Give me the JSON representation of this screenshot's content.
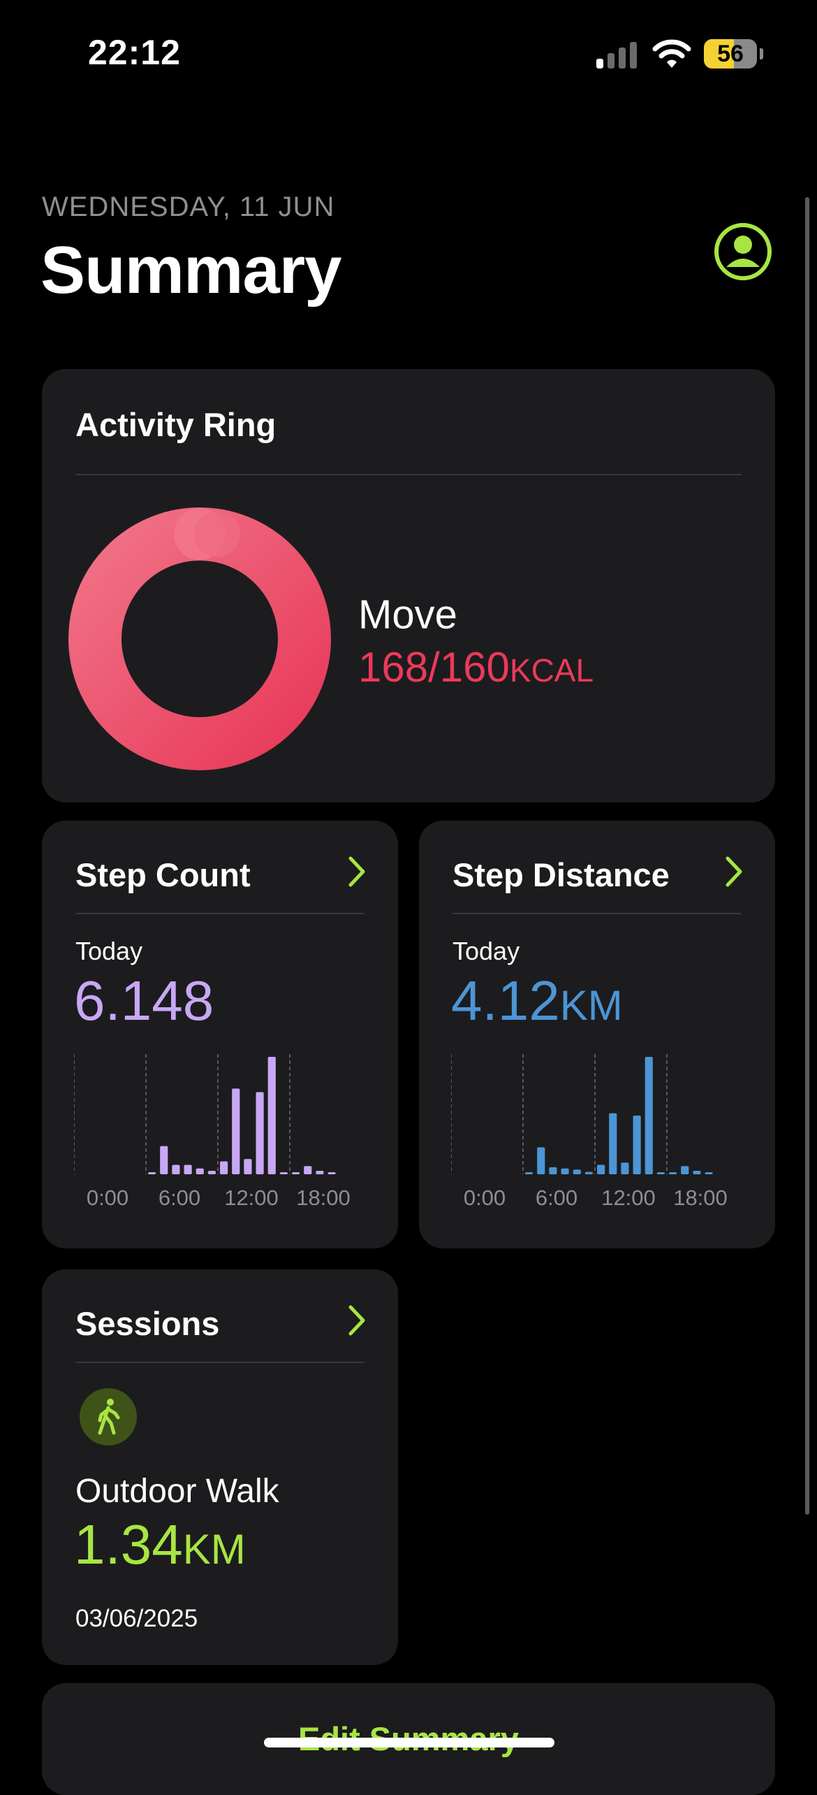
{
  "status_bar": {
    "time": "22:12",
    "signal_icon": "cellular-signal-icon",
    "wifi_icon": "wifi-icon",
    "battery_level": "56",
    "battery_fraction": 0.56,
    "battery_color": "#f5d232"
  },
  "header": {
    "date": "WEDNESDAY, 11 JUN",
    "title": "Summary",
    "profile_icon": "person-circle-icon"
  },
  "colors": {
    "accent": "#a8e543",
    "move_red": "#ec3a5a",
    "steps_purple": "#c8a8f5",
    "distance_blue": "#4c95d6",
    "card_bg": "#1c1c1e"
  },
  "activity_ring": {
    "title": "Activity Ring",
    "label": "Move",
    "value": "168/160",
    "unit": "KCAL",
    "current": 168,
    "goal": 160
  },
  "step_count": {
    "title": "Step Count",
    "period": "Today",
    "value": "6.148",
    "unit": "",
    "chevron_icon": "chevron-right-icon"
  },
  "step_distance": {
    "title": "Step Distance",
    "period": "Today",
    "value": "4.12",
    "unit": "KM",
    "chevron_icon": "chevron-right-icon"
  },
  "sessions": {
    "title": "Sessions",
    "chevron_icon": "chevron-right-icon",
    "workout_icon": "figure-walk-icon",
    "workout_name": "Outdoor Walk",
    "distance": "1.34",
    "unit": "KM",
    "date": "03/06/2025"
  },
  "edit_summary": {
    "label": "Edit Summary"
  },
  "chart_data": [
    {
      "type": "bar",
      "title": "Step Count",
      "x_tick_labels": [
        "0:00",
        "6:00",
        "12:00",
        "18:00"
      ],
      "categories": [
        "0",
        "1",
        "2",
        "3",
        "4",
        "5",
        "6",
        "7",
        "8",
        "9",
        "10",
        "11",
        "12",
        "13",
        "14",
        "15",
        "16",
        "17",
        "18",
        "19",
        "20",
        "21",
        "22",
        "23"
      ],
      "values": [
        0,
        0,
        0,
        0,
        0,
        0,
        1.5,
        24,
        8,
        8,
        5,
        3,
        11,
        73,
        13,
        70,
        100,
        1.5,
        1.5,
        7,
        3,
        1.5,
        0,
        0
      ],
      "color": "#c8a8f5",
      "grid": "vertical dashed at 0:00, 6:00, 12:00, 18:00"
    },
    {
      "type": "bar",
      "title": "Step Distance",
      "x_tick_labels": [
        "0:00",
        "6:00",
        "12:00",
        "18:00"
      ],
      "categories": [
        "0",
        "1",
        "2",
        "3",
        "4",
        "5",
        "6",
        "7",
        "8",
        "9",
        "10",
        "11",
        "12",
        "13",
        "14",
        "15",
        "16",
        "17",
        "18",
        "19",
        "20",
        "21",
        "22",
        "23"
      ],
      "values": [
        0,
        0,
        0,
        0,
        0,
        0,
        1.5,
        23,
        6,
        5,
        4,
        2,
        8,
        52,
        10,
        50,
        100,
        1.5,
        1.5,
        7,
        3,
        1.5,
        0,
        0
      ],
      "color": "#4c95d6",
      "grid": "vertical dashed at 0:00, 6:00, 12:00, 18:00"
    }
  ]
}
